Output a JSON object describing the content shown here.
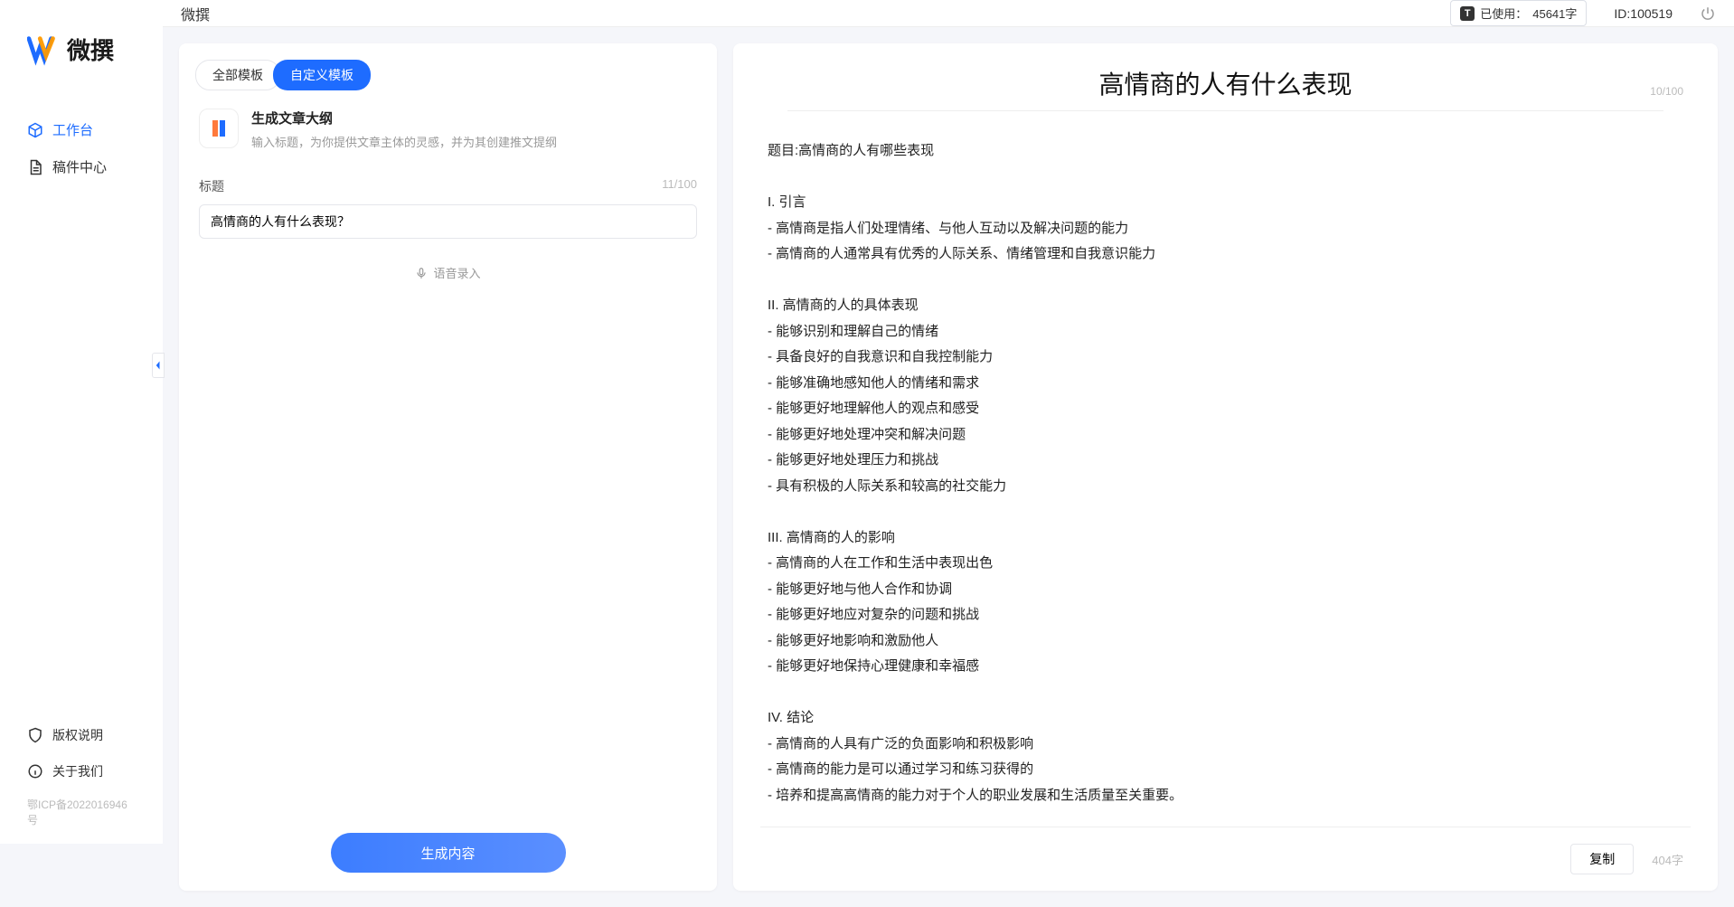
{
  "brand": {
    "name": "微撰"
  },
  "sidebar": {
    "nav": [
      {
        "label": "工作台",
        "icon": "cube-icon",
        "active": true
      },
      {
        "label": "稿件中心",
        "icon": "document-icon",
        "active": false
      }
    ],
    "bottom": [
      {
        "label": "版权说明",
        "icon": "shield-icon"
      },
      {
        "label": "关于我们",
        "icon": "info-icon"
      }
    ],
    "icp": "鄂ICP备2022016946号"
  },
  "topbar": {
    "breadcrumb": "微撰",
    "usage": {
      "prefix": "已使用：",
      "value": "45641字"
    },
    "id_label": "ID:100519"
  },
  "left": {
    "tabs": [
      {
        "label": "全部模板",
        "active": false
      },
      {
        "label": "自定义模板",
        "active": true
      }
    ],
    "template": {
      "title": "生成文章大纲",
      "desc": "输入标题，为你提供文章主体的灵感，并为其创建推文提纲"
    },
    "form": {
      "label": "标题",
      "count": "11/100",
      "value": "高情商的人有什么表现？"
    },
    "voice": "语音录入",
    "generate": "生成内容"
  },
  "right": {
    "title": "高情商的人有什么表现",
    "title_count": "10/100",
    "body": "题目:高情商的人有哪些表现\n\nI. 引言\n- 高情商是指人们处理情绪、与他人互动以及解决问题的能力\n- 高情商的人通常具有优秀的人际关系、情绪管理和自我意识能力\n\nII. 高情商的人的具体表现\n- 能够识别和理解自己的情绪\n- 具备良好的自我意识和自我控制能力\n- 能够准确地感知他人的情绪和需求\n- 能够更好地理解他人的观点和感受\n- 能够更好地处理冲突和解决问题\n- 能够更好地处理压力和挑战\n- 具有积极的人际关系和较高的社交能力\n\nIII. 高情商的人的影响\n- 高情商的人在工作和生活中表现出色\n- 能够更好地与他人合作和协调\n- 能够更好地应对复杂的问题和挑战\n- 能够更好地影响和激励他人\n- 能够更好地保持心理健康和幸福感\n\nIV. 结论\n- 高情商的人具有广泛的负面影响和积极影响\n- 高情商的能力是可以通过学习和练习获得的\n- 培养和提高高情商的能力对于个人的职业发展和生活质量至关重要。",
    "copy": "复制",
    "word_count": "404字"
  }
}
